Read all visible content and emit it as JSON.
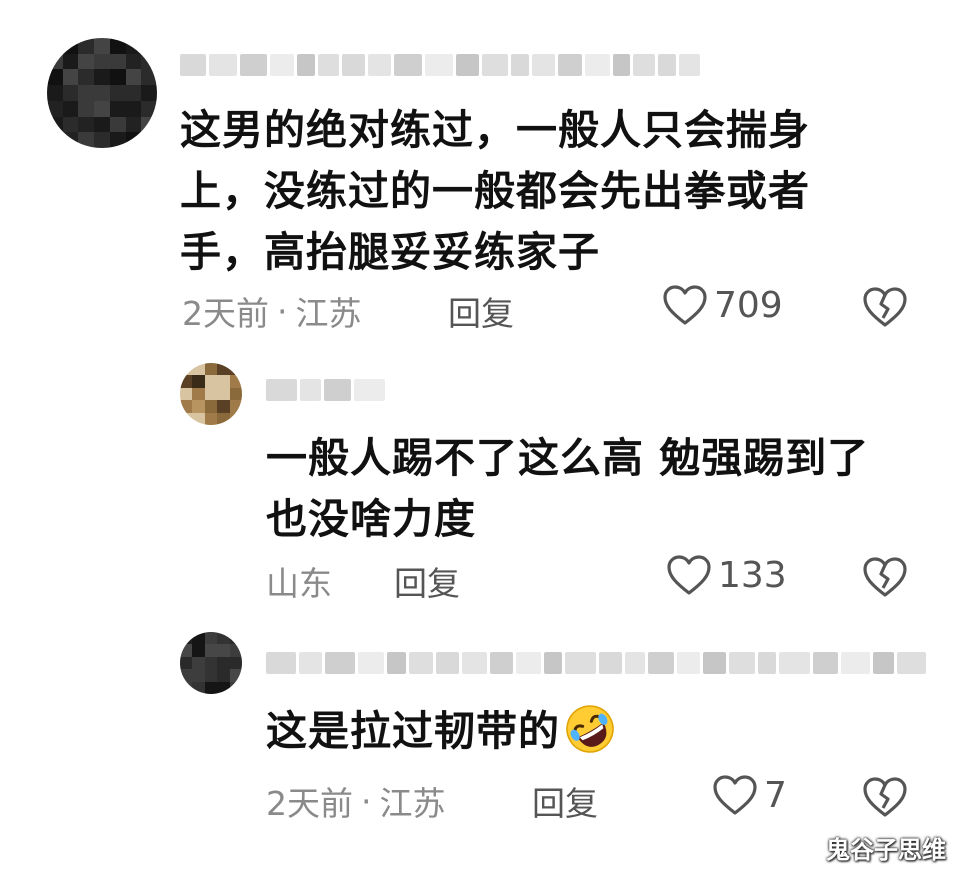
{
  "comments": [
    {
      "text_lines": [
        "这男的绝对练过，一般人只会揣身",
        "上，没练过的一般都会先出拳或者",
        "手，高抬腿妥妥练家子"
      ],
      "time": "2天前",
      "dot": "·",
      "location": "江苏",
      "reply_label": "回复",
      "likes": "709"
    },
    {
      "text_lines": [
        "一般人踢不了这么高 勉强踢到了",
        "也没啥力度"
      ],
      "location": "山东",
      "reply_label": "回复",
      "likes": "133"
    },
    {
      "text_lines": [
        "这是拉过韧带的"
      ],
      "emoji": "rolling-on-floor-laughing-emoji",
      "time": "2天前",
      "dot": "·",
      "location": "江苏",
      "reply_label": "回复",
      "likes": "7"
    }
  ],
  "icons": {
    "like": "heart-outline-icon",
    "dislike": "broken-heart-icon"
  },
  "colors": {
    "text": "#111111",
    "meta": "#8a8a8a",
    "icon": "#555555"
  },
  "watermark": "鬼谷子思维"
}
